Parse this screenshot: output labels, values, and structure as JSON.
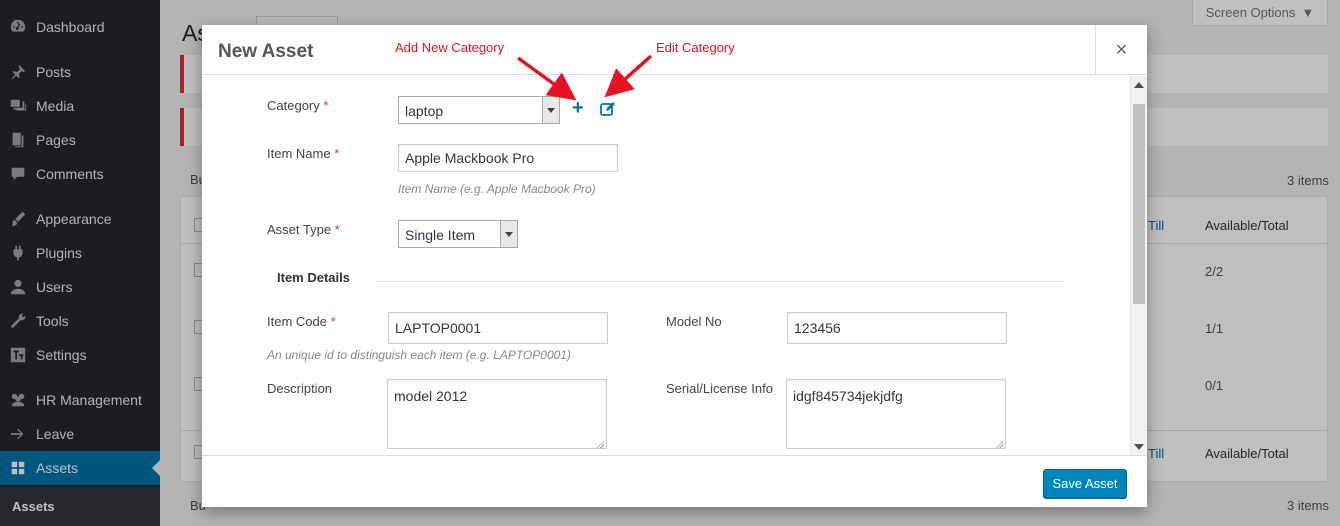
{
  "sidebar": {
    "items": [
      {
        "label": "Dashboard",
        "icon": "dashboard-icon"
      },
      {
        "label": "Posts",
        "icon": "pin-icon"
      },
      {
        "label": "Media",
        "icon": "media-icon"
      },
      {
        "label": "Pages",
        "icon": "pages-icon"
      },
      {
        "label": "Comments",
        "icon": "comment-icon"
      },
      {
        "label": "Appearance",
        "icon": "brush-icon"
      },
      {
        "label": "Plugins",
        "icon": "plugin-icon"
      },
      {
        "label": "Users",
        "icon": "user-icon"
      },
      {
        "label": "Tools",
        "icon": "wrench-icon"
      },
      {
        "label": "Settings",
        "icon": "settings-icon"
      },
      {
        "label": "HR Management",
        "icon": "group-icon"
      },
      {
        "label": "Leave",
        "icon": "arrow-right-icon"
      },
      {
        "label": "Assets",
        "icon": "grid-icon"
      }
    ],
    "current_submenu": "Assets"
  },
  "background": {
    "screen_options": "Screen Options",
    "title_partial": "As",
    "items_count": "3 items",
    "column_till": "Till",
    "column_available": "Available/Total",
    "rows": [
      "2/2",
      "1/1",
      "0/1"
    ],
    "bulk_partial": "Bu"
  },
  "modal": {
    "title": "New Asset",
    "close": "×",
    "category": {
      "label": "Category",
      "required": "*",
      "value": "laptop"
    },
    "item_name": {
      "label": "Item Name",
      "required": "*",
      "value": "Apple Mackbook Pro",
      "hint": "Item Name (e.g. Apple Macbook Pro)"
    },
    "asset_type": {
      "label": "Asset Type",
      "required": "*",
      "value": "Single Item"
    },
    "section_title": "Item  Details",
    "item_code": {
      "label": "Item Code",
      "required": "*",
      "value": "LAPTOP0001",
      "hint": "An unique id to distinguish each item (e.g. LAPTOP0001)"
    },
    "model_no": {
      "label": "Model No",
      "value": "123456"
    },
    "description": {
      "label": "Description",
      "value": "model 2012"
    },
    "serial": {
      "label": "Serial/License Info",
      "value": "idgf845734jekjdfg"
    },
    "save_label": "Save Asset"
  },
  "annotations": {
    "add_category": "Add New Category",
    "edit_category": "Edit Category",
    "color": "#e81123"
  }
}
